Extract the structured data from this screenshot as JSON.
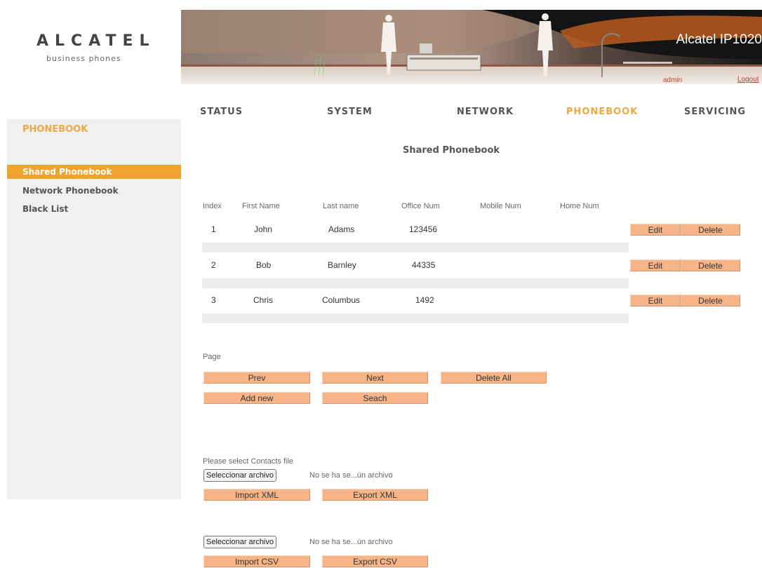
{
  "brand": {
    "name": "ALCATEL",
    "tagline": "business phones"
  },
  "banner": {
    "product": "Alcatel IP1020",
    "user": "admin",
    "logout": "Logout"
  },
  "nav": [
    "STATUS",
    "SYSTEM",
    "NETWORK",
    "PHONEBOOK",
    "SERVICING"
  ],
  "nav_active": "PHONEBOOK",
  "sidebar": {
    "title": "PHONEBOOK",
    "items": [
      "Shared Phonebook",
      "Network Phonebook",
      "Black List"
    ],
    "active": "Shared Phonebook"
  },
  "section_title": "Shared Phonebook",
  "table": {
    "headers": [
      "Index",
      "First Name",
      "Last name",
      "Office Num",
      "Mobile Num",
      "Home Num"
    ],
    "rows": [
      {
        "index": "1",
        "first": "John",
        "last": "Adams",
        "office": "123456",
        "mobile": "",
        "home": ""
      },
      {
        "index": "2",
        "first": "Bob",
        "last": "Barnley",
        "office": "44335",
        "mobile": "",
        "home": ""
      },
      {
        "index": "3",
        "first": "Chris",
        "last": "Columbus",
        "office": "1492",
        "mobile": "",
        "home": ""
      }
    ],
    "edit_label": "Edit",
    "delete_label": "Delete"
  },
  "paging": {
    "page_label": "Page",
    "prev": "Prev",
    "next": "Next",
    "delete_all": "Delete All",
    "add_new": "Add new",
    "search": "Seach"
  },
  "import": {
    "select_label": "Please select Contacts file",
    "choose_file": "Seleccionar archivo",
    "no_file": "No se ha se...ún archivo",
    "import_xml": "Import XML",
    "export_xml": "Export XML",
    "import_csv": "Import CSV",
    "export_csv": "Export CSV"
  },
  "colors": {
    "accent": "#f0a32a",
    "button": "#f6b489",
    "sidebar_bg": "#f0f0f0",
    "link": "#c0392b"
  }
}
